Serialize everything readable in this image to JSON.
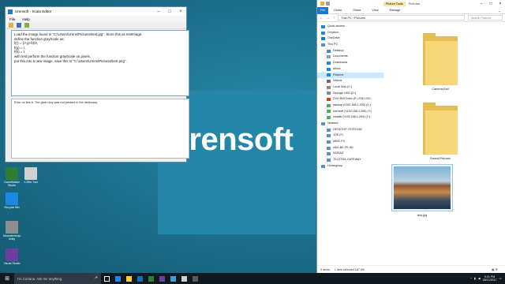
{
  "desktop": {
    "brand": "Urensoft",
    "icons": [
      {
        "label": "GameMaker Studio",
        "color": "#2e7d32"
      },
      {
        "label": "X-Rite Tool",
        "color": "#d0d0d0"
      },
      {
        "label": "Recycle Bin",
        "color": "#1e88e5"
      },
      {
        "label": "Monodevelop-Unity",
        "color": "#8e8e8e"
      },
      {
        "label": "Visual Studio",
        "color": "#6a3fa0"
      }
    ]
  },
  "editor": {
    "title": "Urensoft - Xcala Editor",
    "menu": [
      "File",
      "Help"
    ],
    "code_lines": [
      "Load the image found in \"C:\\Users\\Urens\\Pictures\\test.jpg\". Store this as testImage.",
      "define the function grayScale as:",
      "f(r) = (r+g+b)/3,",
      "f(g) = r,",
      "f(b) = r.",
      "with test perform the function grayScale on pixels,",
      "put this into a new image, save this to \"C:\\Users\\Urens\\Pictures\\test.png\"."
    ],
    "output": "Error on line 6: The given key was not present in the dictionary."
  },
  "explorer": {
    "context_tab": "Picture Tools",
    "folder_name": "Pictures",
    "ribbon": [
      "File",
      "Home",
      "Share",
      "View",
      "Manage"
    ],
    "path": "This PC  ›  Pictures",
    "search_placeholder": "Search Pictures",
    "nav": [
      {
        "label": "Quick access",
        "level": 0,
        "color": "#1e88e5"
      },
      {
        "label": "Dropbox",
        "level": 0,
        "color": "#1e88e5"
      },
      {
        "label": "OneDrive",
        "level": 0,
        "color": "#1976d2"
      },
      {
        "label": "This PC",
        "level": 0,
        "color": "#5c8fc4"
      },
      {
        "label": "Desktop",
        "level": 1,
        "color": "#3a8fd6"
      },
      {
        "label": "Documents",
        "level": 1,
        "color": "#9e9e9e"
      },
      {
        "label": "Downloads",
        "level": 1,
        "color": "#1e88e5"
      },
      {
        "label": "Music",
        "level": 1,
        "color": "#1e88e5"
      },
      {
        "label": "Pictures",
        "level": 1,
        "color": "#1e88e5",
        "selected": true
      },
      {
        "label": "Videos",
        "level": 1,
        "color": "#6d6d6d"
      },
      {
        "label": "Local Disk (C:)",
        "level": 1,
        "color": "#888888"
      },
      {
        "label": "Storage HDD (D:)",
        "level": 1,
        "color": "#888888"
      },
      {
        "label": "DVD RW Drive (E:) ESD-ISO",
        "level": 1,
        "color": "#d84315"
      },
      {
        "label": "backup (\\\\192.168.1.200) (X:)",
        "level": 1,
        "color": "#4caf50"
      },
      {
        "label": "urensoft (\\\\192.168.1.200) (Y:)",
        "level": 1,
        "color": "#4caf50"
      },
      {
        "label": "installs (\\\\192.168.1.200) (Z:)",
        "level": 1,
        "color": "#4caf50"
      },
      {
        "label": "Network",
        "level": 0,
        "color": "#5c8fc4"
      },
      {
        "label": "DESKTOP-7KTEGUM",
        "level": 1,
        "color": "#5c8fc4"
      },
      {
        "label": "JOE-PC",
        "level": 1,
        "color": "#5c8fc4"
      },
      {
        "label": "MIKE-PC",
        "level": 1,
        "color": "#5c8fc4"
      },
      {
        "label": "NAS-BE-FE-9D",
        "level": 1,
        "color": "#5c8fc4"
      },
      {
        "label": "NORAD",
        "level": 1,
        "color": "#5c8fc4"
      },
      {
        "label": "TELSTRA-GATEWAY",
        "level": 1,
        "color": "#5c8fc4"
      },
      {
        "label": "Homegroup",
        "level": 0,
        "color": "#5c8fc4"
      }
    ],
    "items": [
      {
        "label": "Camera Roll",
        "kind": "folder"
      },
      {
        "label": "Saved Pictures",
        "kind": "folder"
      },
      {
        "label": "test.jpg",
        "kind": "image"
      }
    ],
    "status": {
      "count": "3 items",
      "selected": "1 item selected  187 KB"
    }
  },
  "taskbar": {
    "cortana_placeholder": "I'm Cortana. Ask me anything.",
    "apps": [
      "#1e88e5",
      "#ffcc33",
      "#0b6fbd",
      "#2e7d32",
      "#6a3fa0",
      "#3aa0e0",
      "#d0d0d0",
      "#5a5a5a"
    ],
    "time": "9:21 PM",
    "date": "28/12/2017"
  }
}
